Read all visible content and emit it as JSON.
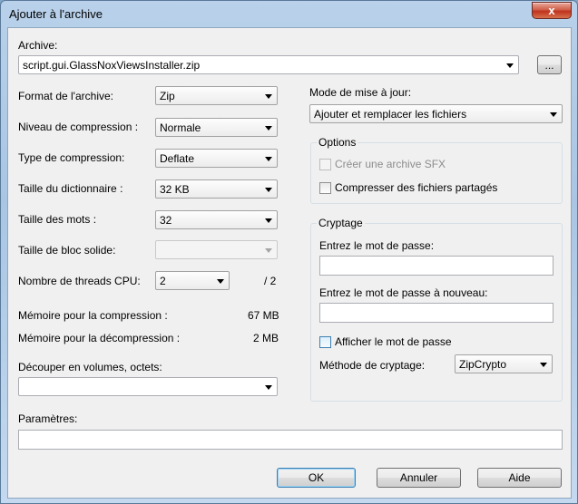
{
  "window": {
    "title": "Ajouter à l'archive",
    "close_glyph": "x"
  },
  "archive": {
    "label": "Archive:",
    "value": "script.gui.GlassNoxViewsInstaller.zip",
    "browse_label": "..."
  },
  "left": {
    "format_label": "Format de l'archive:",
    "format_value": "Zip",
    "level_label": "Niveau de compression :",
    "level_value": "Normale",
    "method_label": "Type de compression:",
    "method_value": "Deflate",
    "dict_label": "Taille du dictionnaire :",
    "dict_value": "32 KB",
    "word_label": "Taille des mots :",
    "word_value": "32",
    "solid_label": "Taille de bloc solide:",
    "solid_value": "",
    "threads_label": "Nombre de threads CPU:",
    "threads_value": "2",
    "threads_total": "/ 2",
    "mem_comp_label": "Mémoire pour la compression :",
    "mem_comp_value": "67 MB",
    "mem_decomp_label": "Mémoire pour la décompression :",
    "mem_decomp_value": "2 MB",
    "split_label": "Découper en volumes, octets:",
    "split_value": ""
  },
  "right": {
    "update_label": "Mode de mise à jour:",
    "update_value": "Ajouter et remplacer les fichiers",
    "options_title": "Options",
    "sfx_label": "Créer une archive SFX",
    "shared_label": "Compresser des fichiers partagés",
    "crypto_title": "Cryptage",
    "password_label": "Entrez le mot de passe:",
    "password_value": "",
    "password2_label": "Entrez le mot de passe à nouveau:",
    "password2_value": "",
    "show_password_label": "Afficher le mot de passe",
    "enc_method_label": "Méthode de cryptage:",
    "enc_method_value": "ZipCrypto"
  },
  "params": {
    "label": "Paramètres:",
    "value": ""
  },
  "buttons": {
    "ok": "OK",
    "cancel": "Annuler",
    "help": "Aide"
  }
}
